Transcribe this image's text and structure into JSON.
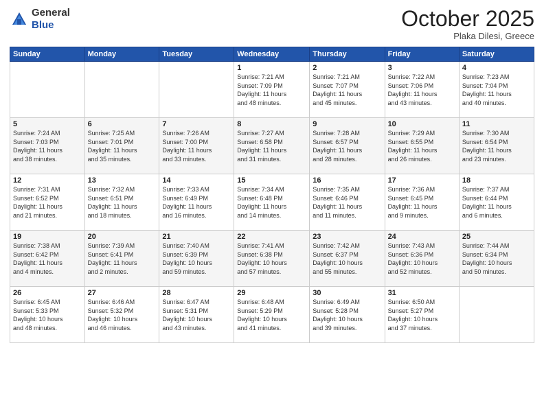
{
  "header": {
    "logo": {
      "line1": "General",
      "line2": "Blue"
    },
    "title": "October 2025",
    "location": "Plaka Dilesi, Greece"
  },
  "weekdays": [
    "Sunday",
    "Monday",
    "Tuesday",
    "Wednesday",
    "Thursday",
    "Friday",
    "Saturday"
  ],
  "weeks": [
    [
      {
        "day": "",
        "info": ""
      },
      {
        "day": "",
        "info": ""
      },
      {
        "day": "",
        "info": ""
      },
      {
        "day": "1",
        "info": "Sunrise: 7:21 AM\nSunset: 7:09 PM\nDaylight: 11 hours\nand 48 minutes."
      },
      {
        "day": "2",
        "info": "Sunrise: 7:21 AM\nSunset: 7:07 PM\nDaylight: 11 hours\nand 45 minutes."
      },
      {
        "day": "3",
        "info": "Sunrise: 7:22 AM\nSunset: 7:06 PM\nDaylight: 11 hours\nand 43 minutes."
      },
      {
        "day": "4",
        "info": "Sunrise: 7:23 AM\nSunset: 7:04 PM\nDaylight: 11 hours\nand 40 minutes."
      }
    ],
    [
      {
        "day": "5",
        "info": "Sunrise: 7:24 AM\nSunset: 7:03 PM\nDaylight: 11 hours\nand 38 minutes."
      },
      {
        "day": "6",
        "info": "Sunrise: 7:25 AM\nSunset: 7:01 PM\nDaylight: 11 hours\nand 35 minutes."
      },
      {
        "day": "7",
        "info": "Sunrise: 7:26 AM\nSunset: 7:00 PM\nDaylight: 11 hours\nand 33 minutes."
      },
      {
        "day": "8",
        "info": "Sunrise: 7:27 AM\nSunset: 6:58 PM\nDaylight: 11 hours\nand 31 minutes."
      },
      {
        "day": "9",
        "info": "Sunrise: 7:28 AM\nSunset: 6:57 PM\nDaylight: 11 hours\nand 28 minutes."
      },
      {
        "day": "10",
        "info": "Sunrise: 7:29 AM\nSunset: 6:55 PM\nDaylight: 11 hours\nand 26 minutes."
      },
      {
        "day": "11",
        "info": "Sunrise: 7:30 AM\nSunset: 6:54 PM\nDaylight: 11 hours\nand 23 minutes."
      }
    ],
    [
      {
        "day": "12",
        "info": "Sunrise: 7:31 AM\nSunset: 6:52 PM\nDaylight: 11 hours\nand 21 minutes."
      },
      {
        "day": "13",
        "info": "Sunrise: 7:32 AM\nSunset: 6:51 PM\nDaylight: 11 hours\nand 18 minutes."
      },
      {
        "day": "14",
        "info": "Sunrise: 7:33 AM\nSunset: 6:49 PM\nDaylight: 11 hours\nand 16 minutes."
      },
      {
        "day": "15",
        "info": "Sunrise: 7:34 AM\nSunset: 6:48 PM\nDaylight: 11 hours\nand 14 minutes."
      },
      {
        "day": "16",
        "info": "Sunrise: 7:35 AM\nSunset: 6:46 PM\nDaylight: 11 hours\nand 11 minutes."
      },
      {
        "day": "17",
        "info": "Sunrise: 7:36 AM\nSunset: 6:45 PM\nDaylight: 11 hours\nand 9 minutes."
      },
      {
        "day": "18",
        "info": "Sunrise: 7:37 AM\nSunset: 6:44 PM\nDaylight: 11 hours\nand 6 minutes."
      }
    ],
    [
      {
        "day": "19",
        "info": "Sunrise: 7:38 AM\nSunset: 6:42 PM\nDaylight: 11 hours\nand 4 minutes."
      },
      {
        "day": "20",
        "info": "Sunrise: 7:39 AM\nSunset: 6:41 PM\nDaylight: 11 hours\nand 2 minutes."
      },
      {
        "day": "21",
        "info": "Sunrise: 7:40 AM\nSunset: 6:39 PM\nDaylight: 10 hours\nand 59 minutes."
      },
      {
        "day": "22",
        "info": "Sunrise: 7:41 AM\nSunset: 6:38 PM\nDaylight: 10 hours\nand 57 minutes."
      },
      {
        "day": "23",
        "info": "Sunrise: 7:42 AM\nSunset: 6:37 PM\nDaylight: 10 hours\nand 55 minutes."
      },
      {
        "day": "24",
        "info": "Sunrise: 7:43 AM\nSunset: 6:36 PM\nDaylight: 10 hours\nand 52 minutes."
      },
      {
        "day": "25",
        "info": "Sunrise: 7:44 AM\nSunset: 6:34 PM\nDaylight: 10 hours\nand 50 minutes."
      }
    ],
    [
      {
        "day": "26",
        "info": "Sunrise: 6:45 AM\nSunset: 5:33 PM\nDaylight: 10 hours\nand 48 minutes."
      },
      {
        "day": "27",
        "info": "Sunrise: 6:46 AM\nSunset: 5:32 PM\nDaylight: 10 hours\nand 46 minutes."
      },
      {
        "day": "28",
        "info": "Sunrise: 6:47 AM\nSunset: 5:31 PM\nDaylight: 10 hours\nand 43 minutes."
      },
      {
        "day": "29",
        "info": "Sunrise: 6:48 AM\nSunset: 5:29 PM\nDaylight: 10 hours\nand 41 minutes."
      },
      {
        "day": "30",
        "info": "Sunrise: 6:49 AM\nSunset: 5:28 PM\nDaylight: 10 hours\nand 39 minutes."
      },
      {
        "day": "31",
        "info": "Sunrise: 6:50 AM\nSunset: 5:27 PM\nDaylight: 10 hours\nand 37 minutes."
      },
      {
        "day": "",
        "info": ""
      }
    ]
  ]
}
